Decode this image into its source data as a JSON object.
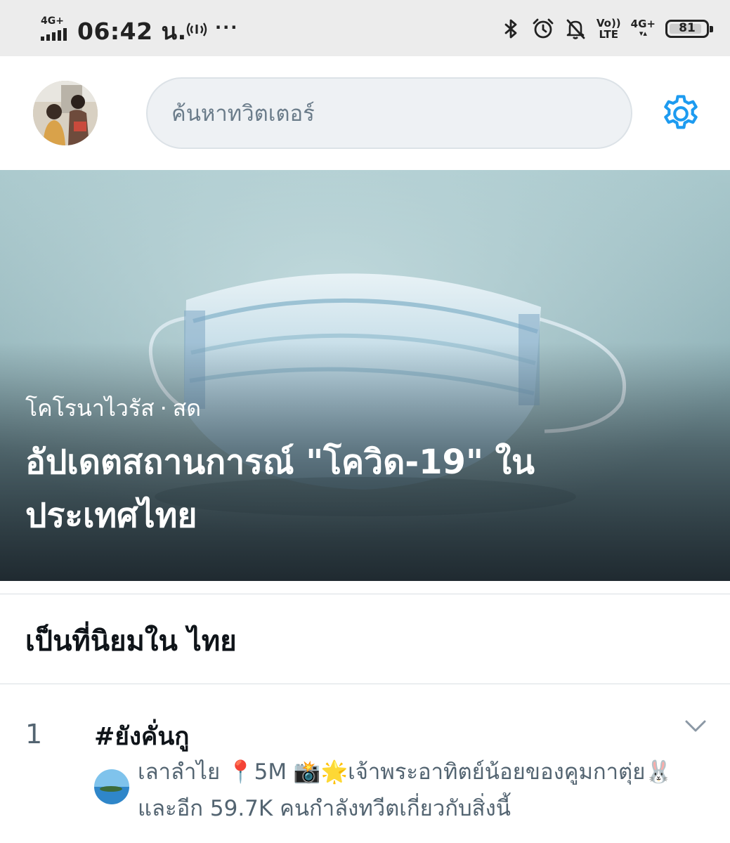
{
  "status_bar": {
    "network_label": "4G+",
    "time": "06:42 น.",
    "hotspot_icon": "hotspot-icon",
    "overflow_dots": "···",
    "icons": [
      "bluetooth-icon",
      "alarm-icon",
      "notifications-off-icon"
    ],
    "volte_label_1": "Vo))",
    "volte_label_2": "LTE",
    "data_label": "4G+",
    "battery_level": "81"
  },
  "header": {
    "avatar_icon": "profile-avatar",
    "search_placeholder": "ค้นหาทวิตเตอร์",
    "settings_icon": "gear-icon"
  },
  "hero": {
    "category": "โคโรนาไวรัส",
    "separator": "·",
    "live_label": "สด",
    "title": "อัปเดตสถานการณ์ \"โควิด-19\" ในประเทศไทย"
  },
  "trends": {
    "section_title": "เป็นที่นิยมใน ไทย",
    "items": [
      {
        "rank": "1",
        "hashtag": "#ยังคั่นกู",
        "context": "เลาลำไย 📍5M 📸🌟เจ้าพระอาทิตย์น้อยของคูมกาตุ่ย🐰 และอีก 59.7K คนกำลังทวีตเกี่ยวกับสิ่งนี้"
      }
    ]
  },
  "colors": {
    "accent": "#1d9bf0",
    "text_primary": "#0f1419",
    "text_secondary": "#536471",
    "status_bar_bg": "#ececec"
  }
}
